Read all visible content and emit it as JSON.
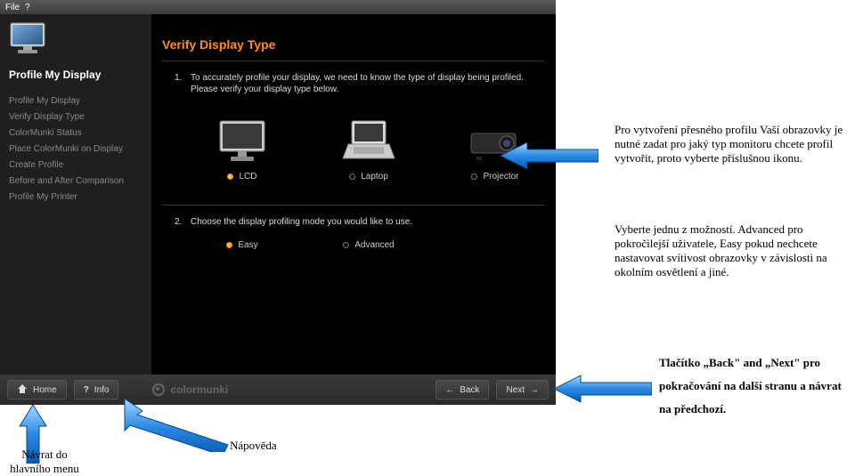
{
  "menubar": {
    "file": "File",
    "help": "?"
  },
  "sidebar": {
    "section_title": "Profile My Display",
    "nav": [
      "Profile My Display",
      "Verify Display Type",
      "ColorMunki Status",
      "Place ColorMunki on Display",
      "Create Profile",
      "Before and After Comparison",
      "Profile My Printer"
    ]
  },
  "content": {
    "title": "Verify Display Type",
    "step1_num": "1.",
    "step1_line1": "To accurately profile your display, we need to know the type of display being profiled.",
    "step1_line2": "Please verify your display type below.",
    "devices": {
      "lcd": "LCD",
      "laptop": "Laptop",
      "projector": "Projector"
    },
    "step2_num": "2.",
    "step2_line": "Choose the display profiling mode you would like to use.",
    "modes": {
      "easy": "Easy",
      "advanced": "Advanced"
    }
  },
  "footer": {
    "home": "Home",
    "info": "Info",
    "brand": "colormunki",
    "back": "Back",
    "next": "Next"
  },
  "anno": {
    "a1": "Pro vytvoření přesného profilu Vaší obrazovky je nutné zadat pro jaký typ monitoru chcete profil vytvořit, proto vyberte příslušnou ikonu.",
    "a2": "Vyberte jednu z možností. Advanced pro pokročilejší uživatele, Easy pokud nechcete nastavovat svítivost obrazovky v závislosti na okolním osvětlení a jiné.",
    "a3a": "Tlačítko „Back\" and „Next\" pro",
    "a3b": "pokračování na další stranu a návrat",
    "a3c": "na předchozí.",
    "a4a": "Návrat do",
    "a4b": "hlavního menu",
    "a5": "Nápověda"
  }
}
